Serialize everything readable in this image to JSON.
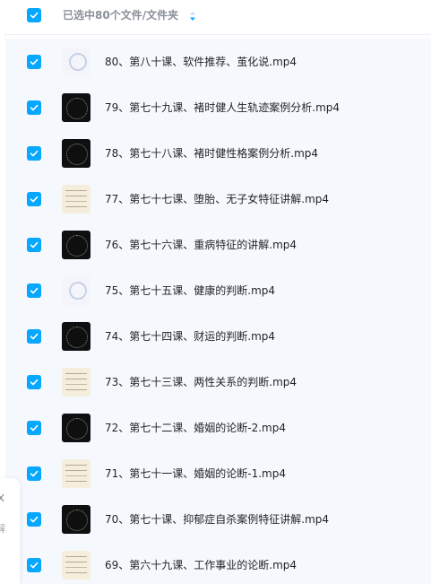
{
  "header": {
    "select_all_checked": true,
    "selection_label": "已选中80个文件/文件夹"
  },
  "colors": {
    "accent": "#06a7ff",
    "list_background": "#f5f9fe",
    "text_primary": "#1f2329",
    "text_secondary": "#8a8f99"
  },
  "files": [
    {
      "name": "80、第八十课、软件推荐、茧化说.mp4",
      "checked": true,
      "thumb": "white"
    },
    {
      "name": "79、第七十九课、褚时健人生轨迹案例分析.mp4",
      "checked": true,
      "thumb": "dark"
    },
    {
      "name": "78、第七十八课、褚时健性格案例分析.mp4",
      "checked": true,
      "thumb": "dark"
    },
    {
      "name": "77、第七十七课、堕胎、无子女特征讲解.mp4",
      "checked": true,
      "thumb": "light"
    },
    {
      "name": "76、第七十六课、重病特征的讲解.mp4",
      "checked": true,
      "thumb": "dark"
    },
    {
      "name": "75、第七十五课、健康的判断.mp4",
      "checked": true,
      "thumb": "white"
    },
    {
      "name": "74、第七十四课、财运的判断.mp4",
      "checked": true,
      "thumb": "dark"
    },
    {
      "name": "73、第七十三课、两性关系的判断.mp4",
      "checked": true,
      "thumb": "light"
    },
    {
      "name": "72、第七十二课、婚姻的论断-2.mp4",
      "checked": true,
      "thumb": "dark"
    },
    {
      "name": "71、第七十一课、婚姻的论断-1.mp4",
      "checked": true,
      "thumb": "light"
    },
    {
      "name": "70、第七十课、抑郁症自杀案例特征讲解.mp4",
      "checked": true,
      "thumb": "dark"
    },
    {
      "name": "69、第六十九课、工作事业的论断.mp4",
      "checked": true,
      "thumb": "light"
    }
  ],
  "side_panel": {
    "text": "解"
  }
}
